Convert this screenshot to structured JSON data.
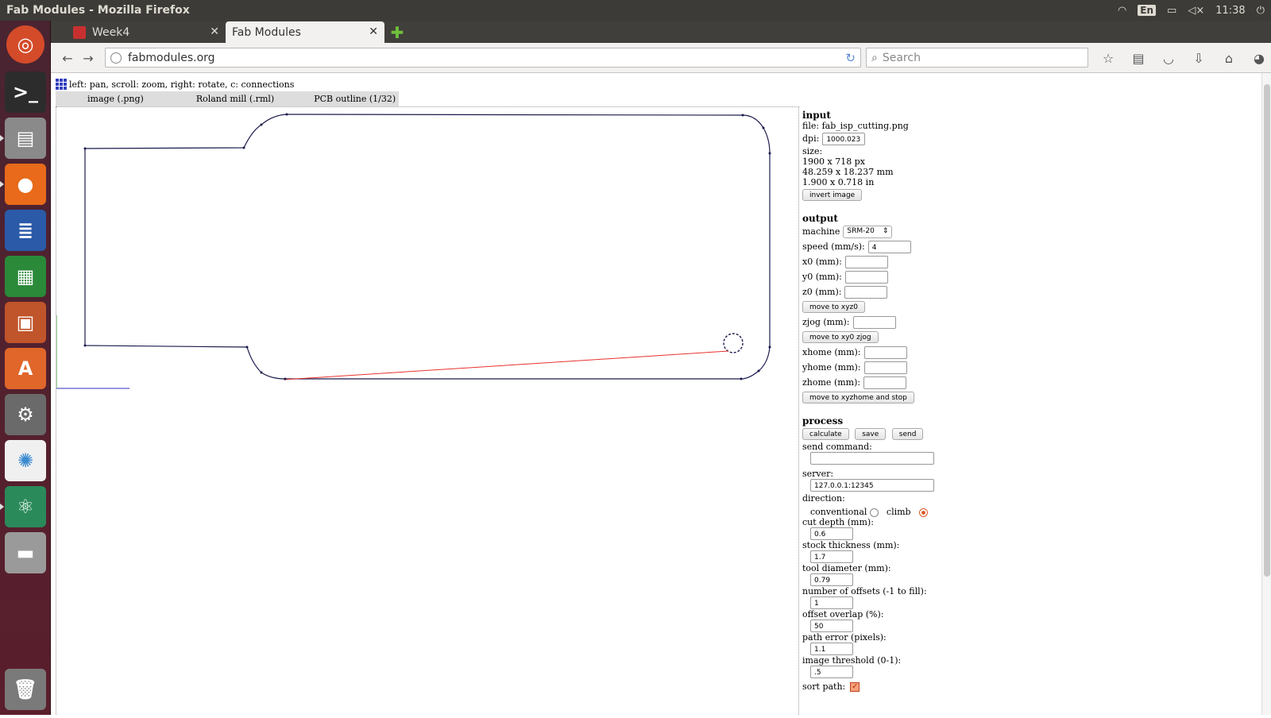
{
  "window_title": "Fab Modules - Mozilla Firefox",
  "indicators": {
    "lang": "En",
    "time": "11:38"
  },
  "tabs": [
    {
      "label": "Week4"
    },
    {
      "label": "Fab Modules"
    }
  ],
  "url": "fabmodules.org",
  "search_placeholder": "Search",
  "hint": "left: pan, scroll: zoom, right: rotate, c: connections",
  "modules": [
    "image (.png)",
    "Roland mill (.rml)",
    "PCB outline (1/32)"
  ],
  "input": {
    "heading": "input",
    "file": "file: fab_isp_cutting.png",
    "dpi_label": "dpi:",
    "dpi": "1000.023",
    "size_label": "size:",
    "size_px": "1900 x 718 px",
    "size_mm": "48.259 x 18.237 mm",
    "size_in": "1.900 x 0.718 in",
    "invert": "invert image"
  },
  "output": {
    "heading": "output",
    "machine_label": "machine",
    "machine": "SRM-20",
    "speed_label": "speed (mm/s):",
    "speed": "4",
    "x0_label": "x0 (mm):",
    "y0_label": "y0 (mm):",
    "z0_label": "z0 (mm):",
    "move_xyz0": "move to xyz0",
    "zjog_label": "zjog (mm):",
    "move_xy0_zjog": "move to xy0 zjog",
    "xhome_label": "xhome (mm):",
    "yhome_label": "yhome (mm):",
    "zhome_label": "zhome (mm):",
    "move_home": "move to xyzhome and stop"
  },
  "process": {
    "heading": "process",
    "calculate": "calculate",
    "save": "save",
    "send": "send",
    "send_command_label": "send command:",
    "server_label": "server:",
    "server": "127.0.0.1:12345",
    "direction_label": "direction:",
    "conventional": "conventional",
    "climb": "climb",
    "cut_depth_label": "cut depth (mm):",
    "cut_depth": "0.6",
    "stock_label": "stock thickness (mm):",
    "stock": "1.7",
    "tool_label": "tool diameter (mm):",
    "tool": "0.79",
    "offsets_label": "number of offsets (-1 to fill):",
    "offsets": "1",
    "overlap_label": "offset overlap (%):",
    "overlap": "50",
    "path_error_label": "path error (pixels):",
    "path_error": "1.1",
    "threshold_label": "image threshold (0-1):",
    "threshold": ".5",
    "sort_label": "sort path:"
  },
  "colors": {
    "path": "#1a1a4e",
    "connection": "#e8322e",
    "axis_x": "#3030c0",
    "axis_y": "#30a030",
    "launcher": "#5a1e2c"
  }
}
